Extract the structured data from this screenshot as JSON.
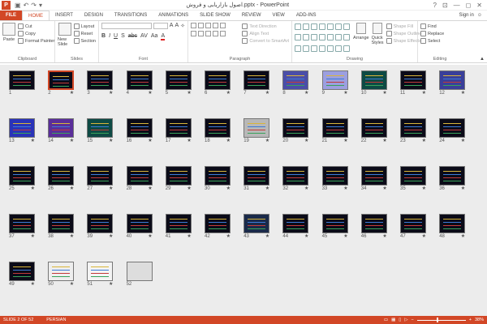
{
  "app": {
    "title": "اصول بازاریابی و فروش.pptx - PowerPoint",
    "logo_letter": "P"
  },
  "window_controls": [
    "?",
    "⊡",
    "—",
    "◻",
    "✕"
  ],
  "tabs": [
    "FILE",
    "HOME",
    "INSERT",
    "DESIGN",
    "TRANSITIONS",
    "ANIMATIONS",
    "SLIDE SHOW",
    "REVIEW",
    "VIEW",
    "ADD-INS"
  ],
  "active_tab": "HOME",
  "signin": "Sign in",
  "ribbon": {
    "clipboard": {
      "label": "Clipboard",
      "paste": "Paste",
      "cut": "Cut",
      "copy": "Copy",
      "format_painter": "Format Painter"
    },
    "slides": {
      "label": "Slides",
      "new_slide": "New Slide",
      "layout": "Layout",
      "reset": "Reset",
      "section": "Section"
    },
    "font": {
      "label": "Font"
    },
    "paragraph": {
      "label": "Paragraph",
      "text_direction": "Text Direction",
      "align_text": "Align Text",
      "convert": "Convert to SmartArt"
    },
    "drawing": {
      "label": "Drawing",
      "arrange": "Arrange",
      "quick_styles": "Quick Styles",
      "shape_fill": "Shape Fill",
      "shape_outline": "Shape Outline",
      "shape_effects": "Shape Effects"
    },
    "editing": {
      "label": "Editing",
      "find": "Find",
      "replace": "Replace",
      "select": "Select"
    }
  },
  "slides": {
    "selected": 2,
    "items": [
      {
        "n": "1",
        "star": ""
      },
      {
        "n": "2",
        "star": "★"
      },
      {
        "n": "3",
        "star": "★"
      },
      {
        "n": "4",
        "star": "★"
      },
      {
        "n": "5",
        "star": "★"
      },
      {
        "n": "6",
        "star": "★"
      },
      {
        "n": "7",
        "star": "★"
      },
      {
        "n": "8",
        "star": "★"
      },
      {
        "n": "9",
        "star": "★"
      },
      {
        "n": "10",
        "star": "★"
      },
      {
        "n": "11",
        "star": "★"
      },
      {
        "n": "12",
        "star": "★"
      },
      {
        "n": "13",
        "star": "★"
      },
      {
        "n": "14",
        "star": "★"
      },
      {
        "n": "15",
        "star": "★"
      },
      {
        "n": "16",
        "star": "★"
      },
      {
        "n": "17",
        "star": "★"
      },
      {
        "n": "18",
        "star": "★"
      },
      {
        "n": "19",
        "star": "★"
      },
      {
        "n": "20",
        "star": "★"
      },
      {
        "n": "21",
        "star": "★"
      },
      {
        "n": "22",
        "star": "★"
      },
      {
        "n": "23",
        "star": "★"
      },
      {
        "n": "24",
        "star": "★"
      },
      {
        "n": "25",
        "star": "★"
      },
      {
        "n": "26",
        "star": "★"
      },
      {
        "n": "27",
        "star": "★"
      },
      {
        "n": "28",
        "star": "★"
      },
      {
        "n": "29",
        "star": "★"
      },
      {
        "n": "30",
        "star": "★"
      },
      {
        "n": "31",
        "star": "★"
      },
      {
        "n": "32",
        "star": "★"
      },
      {
        "n": "33",
        "star": "★"
      },
      {
        "n": "34",
        "star": "★"
      },
      {
        "n": "35",
        "star": "★"
      },
      {
        "n": "36",
        "star": "★"
      },
      {
        "n": "37",
        "star": "★"
      },
      {
        "n": "38",
        "star": "★"
      },
      {
        "n": "39",
        "star": "★"
      },
      {
        "n": "40",
        "star": "★"
      },
      {
        "n": "41",
        "star": "★"
      },
      {
        "n": "42",
        "star": "★"
      },
      {
        "n": "43",
        "star": "★"
      },
      {
        "n": "44",
        "star": "★"
      },
      {
        "n": "45",
        "star": "★"
      },
      {
        "n": "46",
        "star": "★"
      },
      {
        "n": "47",
        "star": "★"
      },
      {
        "n": "48",
        "star": "★"
      },
      {
        "n": "49",
        "star": "★"
      },
      {
        "n": "50",
        "star": "★"
      },
      {
        "n": "51",
        "star": "★"
      },
      {
        "n": "52",
        "star": ""
      }
    ],
    "special": {
      "8": "#4b4ea8",
      "9": "#9c9fe0",
      "10": "#0e4a44",
      "12": "#3a3f9a",
      "13": "#2a33b8",
      "14": "#5a2e9a",
      "15": "#0e4a44",
      "19": "#b8b8b8",
      "43": "#1a2a4a",
      "50": "#eeeeee",
      "51": "#f4f4f4"
    },
    "image_slide": "52"
  },
  "status": {
    "slide_info": "SLIDE 2 OF 52",
    "language": "PERSIAN",
    "zoom": "38%"
  },
  "colors": {
    "accent": "#d24726"
  }
}
